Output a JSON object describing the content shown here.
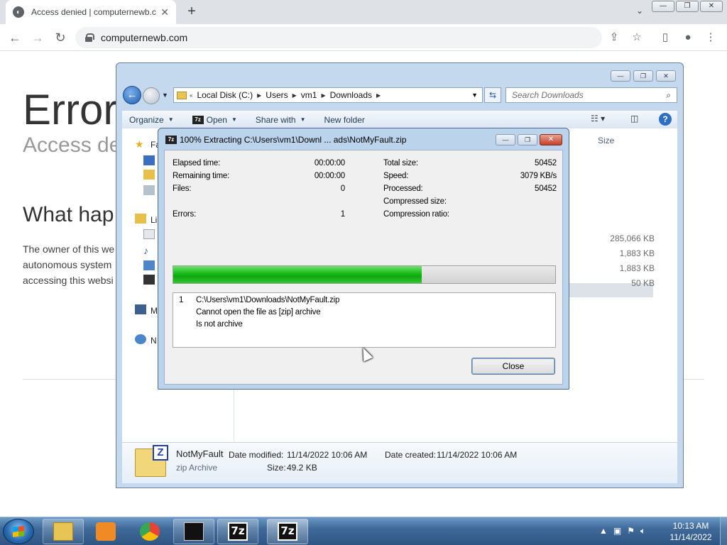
{
  "browser": {
    "tab_title": "Access denied | computernewb.c",
    "url": "computernewb.com",
    "new_tab": "+"
  },
  "page": {
    "title": "Error",
    "subtitle": "Access der",
    "heading": "What hap",
    "body_lines": [
      "The owner of this we",
      "autonomous system",
      "accessing this websi"
    ]
  },
  "explorer": {
    "breadcrumbs": [
      "Local Disk (C:)",
      "Users",
      "vm1",
      "Downloads"
    ],
    "search_placeholder": "Search Downloads",
    "commands": [
      "Organize",
      "Open",
      "Share with",
      "New folder"
    ],
    "nav_items": [
      "Fa",
      "Li",
      "M",
      "N"
    ],
    "column_size": "Size",
    "sizes": [
      "285,066 KB",
      "1,883 KB",
      "1,883 KB",
      "50 KB"
    ],
    "details": {
      "name": "NotMyFault",
      "type": "zip Archive",
      "modified_label": "Date modified:",
      "modified": "11/14/2022 10:06 AM",
      "created_label": "Date created:",
      "created": "11/14/2022 10:06 AM",
      "size_label": "Size:",
      "size": "49.2 KB"
    }
  },
  "dialog": {
    "title": "100% Extracting C:\\Users\\vm1\\Downl ... ads\\NotMyFault.zip",
    "left_stats": [
      {
        "label": "Elapsed time:",
        "value": "00:00:00"
      },
      {
        "label": "Remaining time:",
        "value": "00:00:00"
      },
      {
        "label": "Files:",
        "value": "0"
      },
      {
        "label": "",
        "value": ""
      },
      {
        "label": "Errors:",
        "value": "1"
      }
    ],
    "right_stats": [
      {
        "label": "Total size:",
        "value": "50452"
      },
      {
        "label": "Speed:",
        "value": "3079 KB/s"
      },
      {
        "label": "Processed:",
        "value": "50452"
      },
      {
        "label": "Compressed size:",
        "value": ""
      },
      {
        "label": "Compression ratio:",
        "value": ""
      }
    ],
    "progress": 0.65,
    "messages": {
      "number": "1",
      "lines": [
        "C:\\Users\\vm1\\Downloads\\NotMyFault.zip",
        "Cannot open the file as [zip] archive",
        "Is not archive"
      ]
    },
    "close_label": "Close"
  },
  "taskbar": {
    "time": "10:13 AM",
    "date": "11/14/2022",
    "label_7z": "7z"
  },
  "colors": {
    "progress_green": "#16b916",
    "taskbar_blue": "#3f6a9a"
  }
}
